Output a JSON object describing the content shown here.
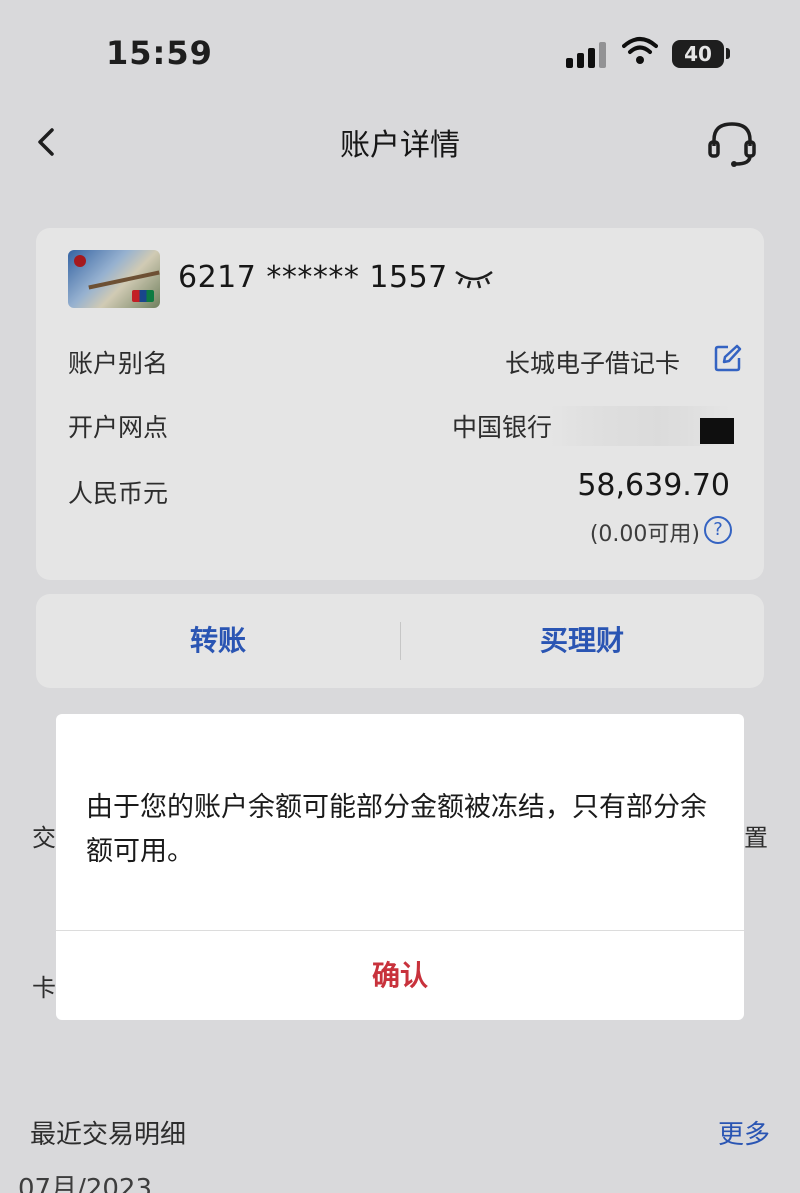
{
  "status_bar": {
    "time": "15:59",
    "battery": "40"
  },
  "nav": {
    "title": "账户详情"
  },
  "card": {
    "number": "6217 ****** 1557",
    "alias_label": "账户别名",
    "alias_value": "长城电子借记卡",
    "branch_label": "开户网点",
    "branch_value": "中国银行",
    "currency_label": "人民币元",
    "balance": "58,639.70",
    "available": "(0.00可用)"
  },
  "actions": {
    "transfer": "转账",
    "buy_wealth": "买理财"
  },
  "background_rows": {
    "row1_left": "交",
    "row1_right": "置",
    "row2_left": "卡"
  },
  "recent": {
    "title": "最近交易明细",
    "more": "更多",
    "month": "07月/2023"
  },
  "dialog": {
    "message": "由于您的账户余额可能部分金额被冻结，只有部分余额可用。",
    "confirm": "确认"
  },
  "colors": {
    "accent_blue": "#2f5fc8",
    "confirm_red": "#c8323c"
  }
}
